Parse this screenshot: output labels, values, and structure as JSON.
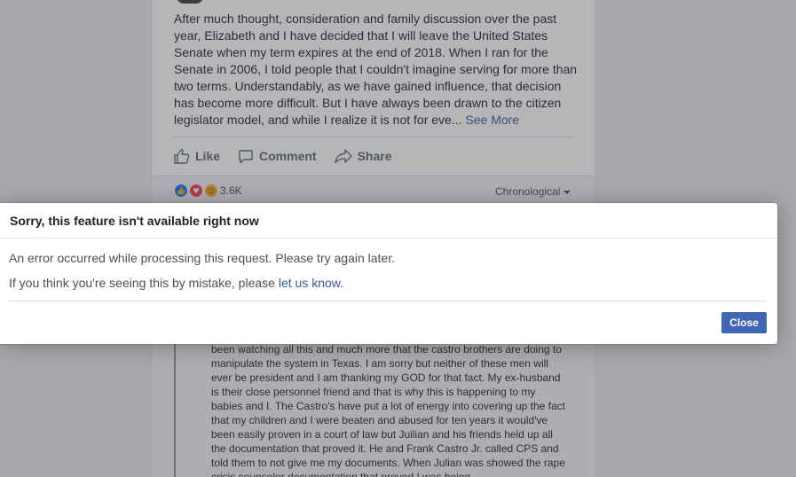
{
  "post": {
    "body": "After much thought, consideration and family discussion over the past year, Elizabeth and I have decided that I will leave the United States Senate when my term expires at the end of 2018. When I ran for the Senate in 2006, I told people that I couldn't imagine serving for more than two terms. Understandably, as we have gained influence, that decision has become more difficult. But I have always been drawn to the citizen legislator model, and while I realize it is not for eve...",
    "see_more": "See More",
    "actions": {
      "like": "Like",
      "comment": "Comment",
      "share": "Share"
    },
    "reactions": {
      "count": "3.6K",
      "icons": [
        "like-reaction",
        "love-reaction",
        "haha-reaction"
      ]
    },
    "sort_label": "Chronological"
  },
  "comment": {
    "text": "been watching all this and much more that the castro brothers are doing to manipulate the system in Texas. I am sorry but neither of these men will ever be president and I am thanking my GOD for that fact. My ex-husband is their close personnel friend and that is why this is happening to my babies and I. The Castro's have put a lot of energy into covering up the fact that my children and I were beaten and abused for ten years it would've been easily proven in a court of law but Juilian and his friends held up all the documentation that proved it. He and Frank Castro Jr. called CPS and told them to not give me my documents. When Julian was showed the rape crisis counselor documentation that proved I was being"
  },
  "dialog": {
    "title": "Sorry, this feature isn't available right now",
    "message": "An error occurred while processing this request. Please try again later.",
    "mistake_prefix": "If you think you're seeing this by mistake, please ",
    "mistake_link": "let us know",
    "mistake_suffix": ".",
    "close_label": "Close"
  },
  "colors": {
    "link": "#385898",
    "primary_button": "#4267b2",
    "page_background": "#e9ebee"
  }
}
